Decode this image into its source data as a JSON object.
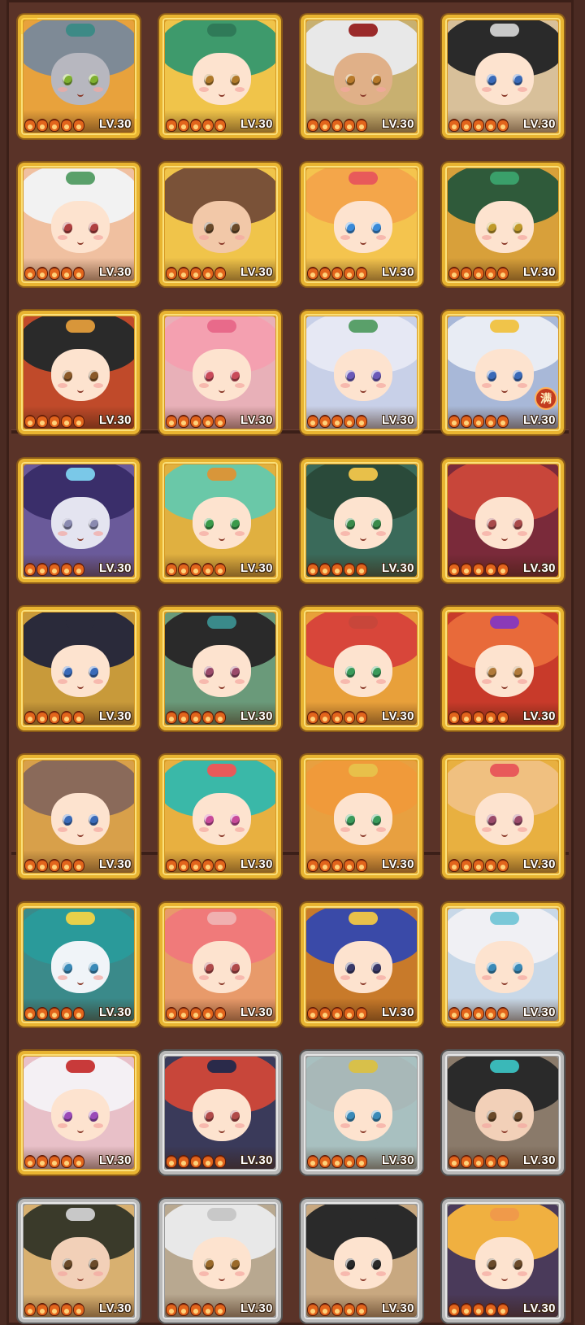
{
  "level_label": "LV.30",
  "max_badge": "满",
  "stars_per_card": 5,
  "cards": [
    {
      "hair": "#7e8a96",
      "bg": "#e8a23c",
      "eye": "#7fb030",
      "skin": "#b7b7bf",
      "orn": "#3d8a86",
      "frame": "gold",
      "selected": true
    },
    {
      "hair": "#3e9a6c",
      "bg": "#f0c44a",
      "eye": "#b07a2a",
      "skin": "#fde3cf",
      "orn": "#2f7a58",
      "frame": "gold"
    },
    {
      "hair": "#e8e8e8",
      "bg": "#c8b070",
      "eye": "#b87a2a",
      "skin": "#e0b088",
      "orn": "#9a2a2a",
      "frame": "gold"
    },
    {
      "hair": "#2a2a2a",
      "bg": "#d8c09a",
      "eye": "#3a6ab8",
      "skin": "#fde3cf",
      "orn": "#c8c8c8",
      "frame": "gold"
    },
    {
      "hair": "#f2f2f2",
      "bg": "#f0c0a0",
      "eye": "#b04040",
      "skin": "#fde3cf",
      "orn": "#5aa06a",
      "frame": "gold"
    },
    {
      "hair": "#7a5238",
      "bg": "#f0c44a",
      "eye": "#6a4a2a",
      "skin": "#f2c8a8",
      "orn": "#7a5238",
      "frame": "gold"
    },
    {
      "hair": "#f4a64a",
      "bg": "#f4c44e",
      "eye": "#3a8ad8",
      "skin": "#fde3cf",
      "orn": "#e85a5a",
      "frame": "gold"
    },
    {
      "hair": "#2f5a3a",
      "bg": "#d8a03a",
      "eye": "#c09a2a",
      "skin": "#fde3cf",
      "orn": "#3aa06a",
      "frame": "gold"
    },
    {
      "hair": "#2a2a2a",
      "bg": "#c04a2a",
      "eye": "#8a5a2a",
      "skin": "#fde3cf",
      "orn": "#d8963a",
      "frame": "gold"
    },
    {
      "hair": "#f4a0b0",
      "bg": "#e8b0b8",
      "eye": "#c84a5a",
      "skin": "#fde3cf",
      "orn": "#e86a8a",
      "frame": "gold"
    },
    {
      "hair": "#e6e8f4",
      "bg": "#c8d0e8",
      "eye": "#6a5ab8",
      "skin": "#fde3cf",
      "orn": "#5aa06a",
      "frame": "gold"
    },
    {
      "hair": "#e8ecf4",
      "bg": "#a8b8d8",
      "eye": "#3a6ab8",
      "skin": "#fde3cf",
      "orn": "#f0c44a",
      "frame": "gold",
      "max": true
    },
    {
      "hair": "#3a2e6a",
      "bg": "#6a5a9a",
      "eye": "#8a8ab0",
      "skin": "#e4e4f0",
      "orn": "#7ac8e8",
      "frame": "gold"
    },
    {
      "hair": "#6ac8a8",
      "bg": "#e0b040",
      "eye": "#3a9a4a",
      "skin": "#fde3cf",
      "orn": "#d8963a",
      "frame": "gold"
    },
    {
      "hair": "#2a4a3a",
      "bg": "#3a6a5a",
      "eye": "#3a8a4a",
      "skin": "#fde3cf",
      "orn": "#e8c04a",
      "frame": "gold"
    },
    {
      "hair": "#c8463a",
      "bg": "#7a2a3a",
      "eye": "#a84a4a",
      "skin": "#fde3cf",
      "orn": "#c8463a",
      "frame": "gold"
    },
    {
      "hair": "#2a2a3a",
      "bg": "#c89a3a",
      "eye": "#3a6ab8",
      "skin": "#fde3cf",
      "orn": "#2a2a3a",
      "frame": "gold"
    },
    {
      "hair": "#2a2a2a",
      "bg": "#6a9a7a",
      "eye": "#9a4a6a",
      "skin": "#fde3cf",
      "orn": "#3a8a8a",
      "frame": "gold"
    },
    {
      "hair": "#d8463a",
      "bg": "#e8a03a",
      "eye": "#3a9a5a",
      "skin": "#fde3cf",
      "orn": "#c8463a",
      "frame": "gold"
    },
    {
      "hair": "#e86a3a",
      "bg": "#c83a2a",
      "eye": "#b07a3a",
      "skin": "#fde3cf",
      "orn": "#8a3ab8",
      "frame": "gold"
    },
    {
      "hair": "#8a6a5a",
      "bg": "#d8a04a",
      "eye": "#3a6ab8",
      "skin": "#fde3cf",
      "orn": "#8a6a5a",
      "frame": "gold"
    },
    {
      "hair": "#3ab8a8",
      "bg": "#e8b040",
      "eye": "#c84a9a",
      "skin": "#fde3cf",
      "orn": "#e85a5a",
      "frame": "gold"
    },
    {
      "hair": "#f09a3a",
      "bg": "#e8a040",
      "eye": "#3a9a5a",
      "skin": "#fde3cf",
      "orn": "#e8c04a",
      "frame": "gold"
    },
    {
      "hair": "#f0c080",
      "bg": "#e8b040",
      "eye": "#9a4a6a",
      "skin": "#fde3cf",
      "orn": "#e85a5a",
      "frame": "gold"
    },
    {
      "hair": "#2a9a9a",
      "bg": "#3a8a8a",
      "eye": "#3a8ab8",
      "skin": "#f0f4f8",
      "orn": "#e8d04a",
      "frame": "gold"
    },
    {
      "hair": "#f07a7a",
      "bg": "#e89a6a",
      "eye": "#b04a4a",
      "skin": "#fde3cf",
      "orn": "#f0b0b0",
      "frame": "gold"
    },
    {
      "hair": "#3a4aa8",
      "bg": "#c87a2a",
      "eye": "#3a3a6a",
      "skin": "#fde3cf",
      "orn": "#e8c04a",
      "frame": "gold"
    },
    {
      "hair": "#f0f0f4",
      "bg": "#c8d8e8",
      "eye": "#3a8ab8",
      "skin": "#fde3cf",
      "orn": "#7ac8d8",
      "frame": "gold"
    },
    {
      "hair": "#f4f0f4",
      "bg": "#e8c0c8",
      "eye": "#9a4ab8",
      "skin": "#fde3cf",
      "orn": "#c83a3a",
      "frame": "gold"
    },
    {
      "hair": "#c8463a",
      "bg": "#3a3a5a",
      "eye": "#b04a4a",
      "skin": "#fde3cf",
      "orn": "#2a2a4a",
      "frame": "silver"
    },
    {
      "hair": "#a8b8b8",
      "bg": "#a8c0c0",
      "eye": "#3a8ab8",
      "skin": "#fde3cf",
      "orn": "#d8c04a",
      "frame": "silver"
    },
    {
      "hair": "#2a2a2a",
      "bg": "#8a7a6a",
      "eye": "#6a4a2a",
      "skin": "#f2d0b8",
      "orn": "#3ab8b8",
      "frame": "silver"
    },
    {
      "hair": "#3a3a2a",
      "bg": "#d8b070",
      "eye": "#6a4a2a",
      "skin": "#f2d0b8",
      "orn": "#c8c8c8",
      "frame": "silver"
    },
    {
      "hair": "#e8e8e8",
      "bg": "#b8a890",
      "eye": "#9a6a2a",
      "skin": "#fde3cf",
      "orn": "#c8c8c8",
      "frame": "silver"
    },
    {
      "hair": "#2a2a2a",
      "bg": "#c8a880",
      "eye": "#2a2a2a",
      "skin": "#fde3cf",
      "orn": "#2a2a2a",
      "frame": "silver"
    },
    {
      "hair": "#f0b040",
      "bg": "#4a3a5a",
      "eye": "#6a4a2a",
      "skin": "#fde3cf",
      "orn": "#f09a4a",
      "frame": "silver"
    }
  ]
}
